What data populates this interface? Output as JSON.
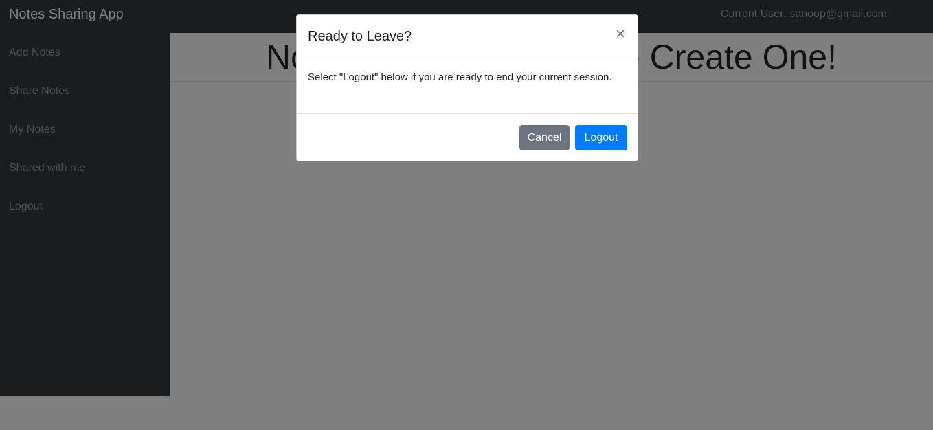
{
  "navbar": {
    "brand": "Notes Sharing App",
    "current_user": "Current User: sanoop@gmail.com"
  },
  "sidebar": {
    "items": [
      {
        "label": "Add Notes"
      },
      {
        "label": "Share Notes"
      },
      {
        "label": "My Notes"
      },
      {
        "label": "Shared with me"
      },
      {
        "label": "Logout"
      }
    ]
  },
  "main": {
    "heading": "No Notes Found, Please Create One!"
  },
  "modal": {
    "title": "Ready to Leave?",
    "close_symbol": "×",
    "body": "Select \"Logout\" below if you are ready to end your current session.",
    "cancel_label": "Cancel",
    "logout_label": "Logout"
  },
  "colors": {
    "navbar_bg": "#343a40",
    "primary": "#007bff",
    "secondary": "#6c757d"
  }
}
